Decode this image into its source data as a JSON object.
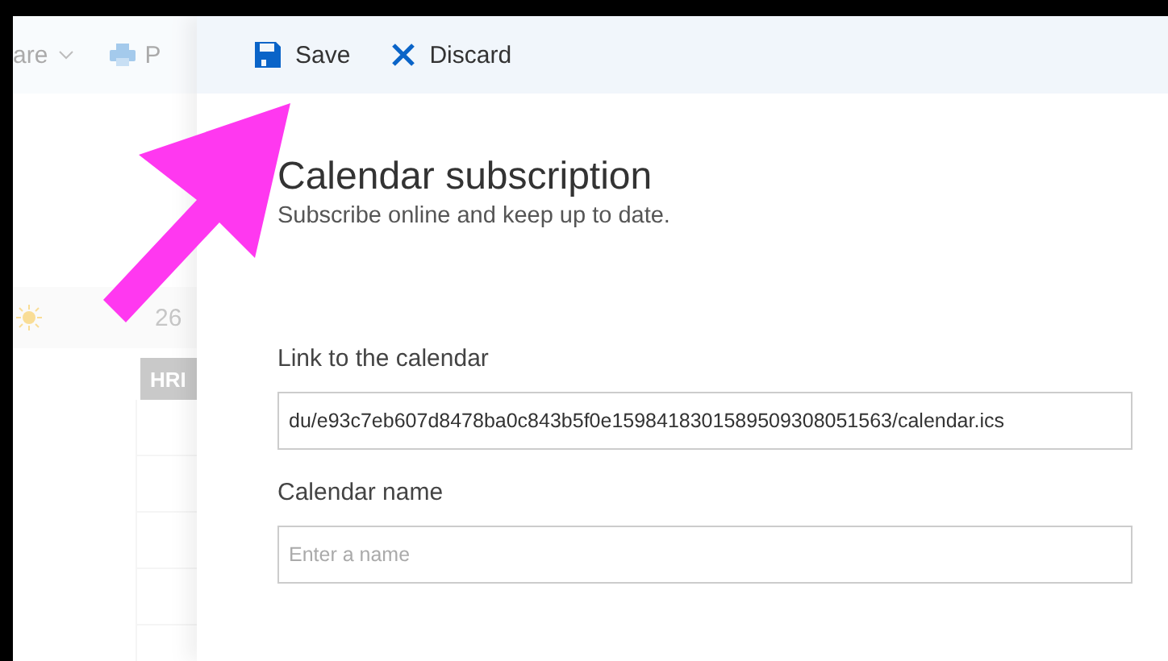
{
  "background": {
    "toolbar": [
      {
        "label": "are"
      },
      {
        "label": "P"
      }
    ],
    "day": {
      "date": "26"
    },
    "event": {
      "label": "HRI"
    }
  },
  "toolbar": {
    "buttons": [
      {
        "kind": "save",
        "label": "Save"
      },
      {
        "kind": "discard",
        "label": "Discard"
      }
    ]
  },
  "panel": {
    "title": "Calendar subscription",
    "subtitle": "Subscribe online and keep up to date.",
    "fields": [
      {
        "label": "Link to the calendar",
        "value": "du/e93c7eb607d8478ba0c843b5f0e1598418301589509308051563/calendar.ics"
      },
      {
        "label": "Calendar name",
        "placeholder": "Enter a name"
      }
    ]
  }
}
